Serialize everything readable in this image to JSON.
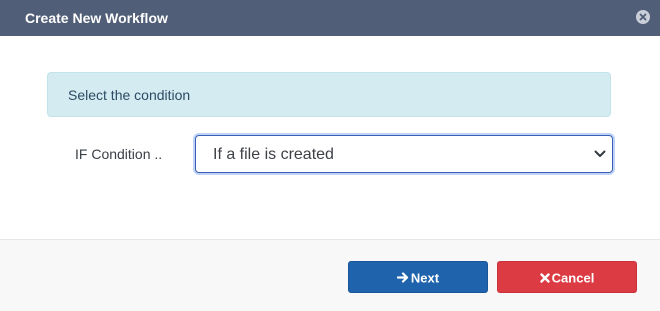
{
  "dialog": {
    "title": "Create New Workflow",
    "close_icon": "close-circle-icon",
    "header_color": "#515e78"
  },
  "info": {
    "text": "Select the condition",
    "background": "#d4ebf1"
  },
  "condition": {
    "label": "IF Condition ..",
    "selected_value": "If a file is created",
    "chevron_icon": "chevron-down-icon"
  },
  "footer": {
    "next_label": "Next",
    "next_icon": "arrow-right-icon",
    "next_color": "#1f63ad",
    "cancel_label": "Cancel",
    "cancel_icon": "times-icon",
    "cancel_color": "#dc3b44"
  }
}
